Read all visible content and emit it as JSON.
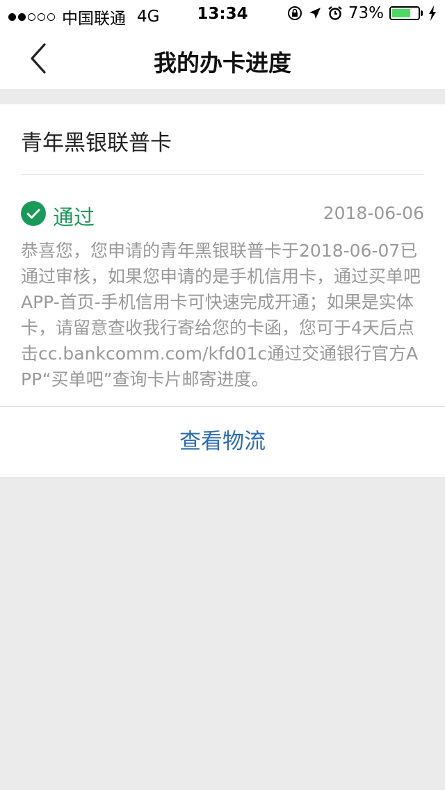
{
  "status_bar": {
    "carrier": "中国联通",
    "network": "4G",
    "time": "13:34",
    "battery": "73%",
    "battery_level": 0.73
  },
  "nav": {
    "title": "我的办卡进度"
  },
  "card": {
    "name": "青年黑银联普卡",
    "status": "通过",
    "date": "2018-06-06",
    "message": "恭喜您，您申请的青年黑银联普卡于2018-06-07已通过审核，如果您申请的是手机信用卡，通过买单吧APP-首页-手机信用卡可快速完成开通；如果是实体卡，请留意查收我行寄给您的卡函，您可于4天后点击cc.bankcomm.com/kfd01c通过交通银行官方APP“买单吧”查询卡片邮寄进度。",
    "action_label": "查看物流"
  },
  "colors": {
    "success": "#1a9a5a",
    "link": "#2b6cb0",
    "battery": "#4cd964"
  },
  "icons": [
    "back-chevron-icon",
    "check-circle-icon",
    "lock-rotation-icon",
    "location-arrow-icon",
    "alarm-icon",
    "battery-icon",
    "charging-bolt-icon"
  ]
}
